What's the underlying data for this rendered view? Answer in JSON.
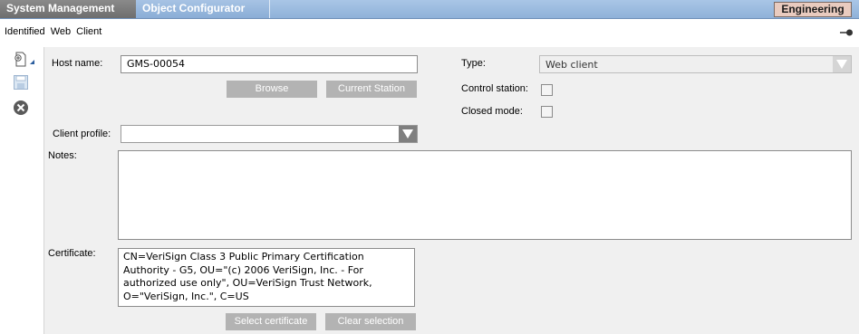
{
  "header": {
    "tabs": [
      {
        "label": "System Management"
      },
      {
        "label": "Object Configurator"
      }
    ],
    "mode_label": "Engineering"
  },
  "breadcrumb": {
    "text": "Identified Web Client"
  },
  "toolbar": {
    "icons": [
      "new-object-icon",
      "save-icon",
      "close-icon"
    ]
  },
  "form": {
    "host_name": {
      "label": "Host name:",
      "value": "GMS-00054"
    },
    "browse_label": "Browse",
    "current_station_label": "Current Station",
    "type": {
      "label": "Type:",
      "value": "Web client"
    },
    "control_station": {
      "label": "Control station:",
      "checked": false
    },
    "closed_mode": {
      "label": "Closed mode:",
      "checked": false
    },
    "client_profile": {
      "label": "Client profile:",
      "value": ""
    },
    "notes": {
      "label": "Notes:",
      "value": ""
    },
    "certificate": {
      "label": "Certificate:",
      "lines": [
        "CN=VeriSign Class 3 Public Primary Certification",
        "Authority - G5, OU=\"(c) 2006 VeriSign, Inc. - For",
        "authorized use only\", OU=VeriSign Trust Network,",
        "O=\"VeriSign, Inc.\", C=US"
      ]
    },
    "select_certificate_label": "Select certificate",
    "clear_selection_label": "Clear selection"
  },
  "colors": {
    "header_blue": "#9dbde2",
    "active_tab": "#7c7c7c",
    "engineering_badge": "#e9cbbf",
    "button_gray": "#b3b3b3",
    "panel_bg": "#f0f0f0"
  }
}
